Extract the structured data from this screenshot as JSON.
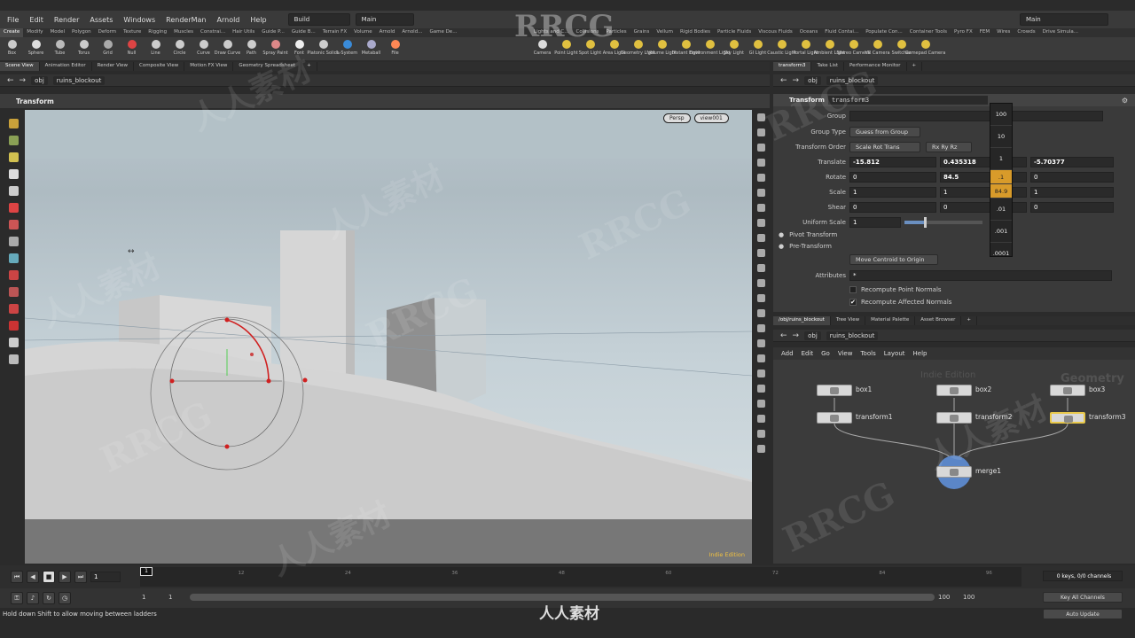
{
  "menu": [
    "File",
    "Edit",
    "Render",
    "Assets",
    "Windows",
    "RenderMan",
    "Arnold",
    "Help"
  ],
  "desktop_left": "Build",
  "desktop_right": "Main",
  "desktop_right2": "Main",
  "shelf_tabs_left": [
    "Create",
    "Modify",
    "Model",
    "Polygon",
    "Deform",
    "Texture",
    "Rigging",
    "Muscles",
    "Constrai...",
    "Hair Utils",
    "Guide P...",
    "Guide B...",
    "Terrain FX",
    "Volume",
    "Arnold",
    "Arnold...",
    "Game De..."
  ],
  "shelf_tabs_right": [
    "Lights and C...",
    "Collisions",
    "Particles",
    "Grains",
    "Vellum",
    "Rigid Bodies",
    "Particle Fluids",
    "Viscous Fluids",
    "Oceans",
    "Fluid Contai...",
    "Populate Con...",
    "Container Tools",
    "Pyro FX",
    "FEM",
    "Wires",
    "Crowds",
    "Drive Simula..."
  ],
  "shelf_tools_left": [
    "Box",
    "Sphere",
    "Tube",
    "Torus",
    "Grid",
    "Null",
    "Line",
    "Circle",
    "Curve",
    "Draw Curve",
    "Path",
    "Spray Paint",
    "Font",
    "Platonic Solids",
    "L-System",
    "Metaball",
    "File"
  ],
  "shelf_tools_right": [
    "Camera",
    "Point Light",
    "Spot Light",
    "Area Light",
    "Geometry Light",
    "Volume Light",
    "Distant Light",
    "Environment Light",
    "Sky Light",
    "GI Light",
    "Caustic Light",
    "Portal Light",
    "Ambient Light",
    "Stereo Camera",
    "VR Camera",
    "Switcher",
    "Gamepad Camera"
  ],
  "left_pane_tabs": [
    "Scene View",
    "Animation Editor",
    "Render View",
    "Composite View",
    "Motion FX View",
    "Geometry Spreadsheet"
  ],
  "path_obj": "obj",
  "path_node": "ruins_blockout",
  "viewport_title": "Transform",
  "persp_label": "Persp",
  "camera_label": "view001",
  "indie_label": "Indie Edition",
  "right_top_tabs": [
    "transform3",
    "Take List",
    "Performance Monitor"
  ],
  "param_header_type": "Transform",
  "param_header_name": "transform3",
  "params": {
    "group_label": "Group",
    "group_type_label": "Group Type",
    "group_type_value": "Guess from Group",
    "xform_order_label": "Transform Order",
    "xform_order_value": "Scale Rot Trans",
    "rot_order_value": "Rx Ry Rz",
    "translate_label": "Translate",
    "translate": [
      "-15.812",
      "0.435318",
      "-5.70377"
    ],
    "rotate_label": "Rotate",
    "rotate": [
      "0",
      "84.5",
      "0"
    ],
    "scale_label": "Scale",
    "scale": [
      "1",
      "1",
      "1"
    ],
    "shear_label": "Shear",
    "shear": [
      "0",
      "0",
      "0"
    ],
    "uniform_scale_label": "Uniform Scale",
    "uniform_scale": "1",
    "uniform_scale_slider": 0.25,
    "pivot_label": "Pivot Transform",
    "pretransform_label": "Pre-Transform",
    "move_centroid_label": "Move Centroid to Origin",
    "attributes_label": "Attributes",
    "attributes_value": "*",
    "recompute_point_label": "Recompute Point Normals",
    "recompute_affected_label": "Recompute Affected Normals"
  },
  "ladder": [
    "100",
    "10",
    "1",
    ".1",
    "84.9",
    ".01",
    ".001",
    ".0001"
  ],
  "network_tabs": [
    "/obj/ruins_blockout",
    "Tree View",
    "Material Palette",
    "Asset Browser"
  ],
  "network_menu": [
    "Add",
    "Edit",
    "Go",
    "View",
    "Tools",
    "Layout",
    "Help"
  ],
  "network_watermark_left": "Indie Edition",
  "network_watermark_right": "Geometry",
  "nodes": {
    "box1": "box1",
    "box2": "box2",
    "box3": "box3",
    "transform1": "transform1",
    "transform2": "transform2",
    "transform3": "transform3",
    "merge1": "merge1"
  },
  "timeline": {
    "current_frame": "1",
    "ticks": [
      "12",
      "24",
      "36",
      "48",
      "60",
      "72",
      "84",
      "96"
    ],
    "range_start": "1",
    "range_start2": "1",
    "range_end": "100",
    "range_end2": "100",
    "keys_label": "0 keys, 0/0 channels",
    "key_all_label": "Key All Channels",
    "auto_update_label": "Auto Update"
  },
  "status_message": "Hold down Shift to allow moving between ladders",
  "watermarks": {
    "brand": "RRCG",
    "cn": "人人素材"
  }
}
